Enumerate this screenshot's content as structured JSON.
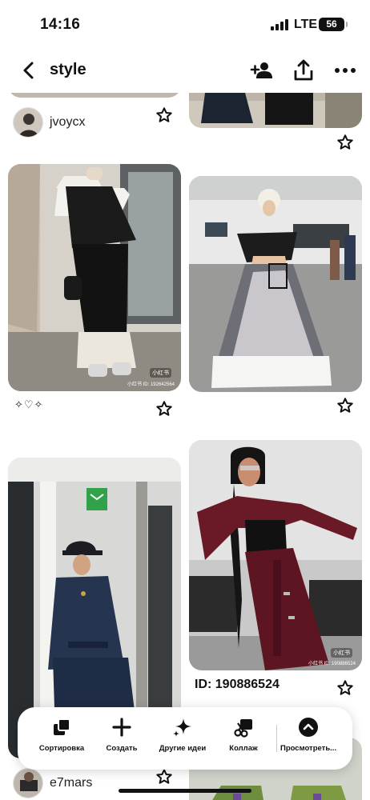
{
  "status_bar": {
    "time": "14:16",
    "network": "LTE",
    "battery": "56"
  },
  "header": {
    "title": "style"
  },
  "pins": [
    {
      "username": "jvoycx"
    },
    {
      "username": ""
    },
    {
      "username": ""
    },
    {
      "decoration": "✧♡✧"
    },
    {
      "id_label": "ID: 190886524"
    },
    {
      "username": "e7mars"
    }
  ],
  "image_badges": {
    "pin2_badge": "小红书",
    "pin2_id": "小红书 ID: 192642564",
    "pin5_badge": "小红书",
    "pin5_id": "小红书 ID: 190886524"
  },
  "actions": [
    {
      "label": "Сортировка",
      "icon": "sort-icon"
    },
    {
      "label": "Создать",
      "icon": "plus-icon"
    },
    {
      "label": "Другие идеи",
      "icon": "sparkle-icon"
    },
    {
      "label": "Коллаж",
      "icon": "scissors-icon"
    },
    {
      "label": "Просмотреть...",
      "icon": "chevron-up-icon"
    }
  ],
  "colors": {
    "accent": "#111111",
    "background": "#ffffff"
  }
}
